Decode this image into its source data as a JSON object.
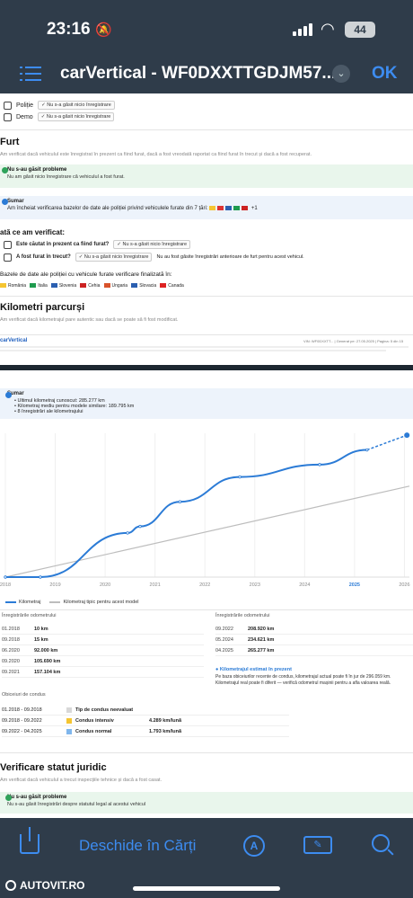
{
  "status_bar": {
    "time": "23:16",
    "battery": "44"
  },
  "nav": {
    "title": "carVertical - WF0DXXTTGDJM57...",
    "ok": "OK"
  },
  "page1": {
    "top_rows": [
      {
        "label": "Poliție",
        "chip": "Nu s-a găsit nicio înregistrare"
      },
      {
        "label": "Demo",
        "chip": "Nu s-a găsit nicio înregistrare"
      }
    ],
    "furt": {
      "heading": "Furt",
      "subtitle": "Am verificat dacă vehiculul este înregistrat în prezent ca fiind furat, dacă a fost vreodată raportat ca fiind furat în trecut și dacă a fost recuperat.",
      "ok_title": "Nu s-au găsit probleme",
      "ok_desc": "Nu am găsit nicio înregistrare că vehiculul a fost furat.",
      "summary_title": "Sumar",
      "summary_text": "Am încheiat verificarea bazelor de date ale poliției privind vehiculele furate din 7 țări:",
      "summary_more": "+1",
      "checked_heading": "ată ce am verificat:",
      "q1": "Este căutat în prezent ca fiind furat?",
      "q1_chip": "Nu s-a găsit nicio înregistrare",
      "q2": "A fost furat în trecut?",
      "q2_chip": "Nu s-a găsit nicio înregistrare",
      "q2_note": "Nu au fost găsite înregistrări anterioare de furt pentru acest vehicul.",
      "db_heading": "Bazele de date ale poliției cu vehicule furate verificare finalizată în:",
      "countries": [
        "România",
        "Italia",
        "Slovenia",
        "Cehia",
        "Ungaria",
        "Slovacia",
        "Canada"
      ]
    },
    "km": {
      "heading": "Kilometri parcurși",
      "subtitle": "Am verificat dacă kilometrajul pare autentic sau dacă se poate să fi fost modificat."
    },
    "footer": {
      "brand": "carVertical",
      "vin": "VIN: WF0DXXTT...",
      "gen": "Generat pe: 27.05.2025",
      "page": "Pagina: 5 din 15"
    }
  },
  "page2": {
    "summary": {
      "title": "Sumar",
      "items": [
        "Ultimul kilometraj cunoscut: 285.277 km",
        "Kilometraj mediu pentru modele similare: 189.795 km",
        "8 înregistrări ale kilometrajului"
      ]
    },
    "chart_data": {
      "type": "line",
      "x_ticks": [
        "2018",
        "2019",
        "2020",
        "2021",
        "2022",
        "2023",
        "2024",
        "2025",
        "2026"
      ],
      "ylim": [
        0,
        300000
      ],
      "series": [
        {
          "name": "Kilometraj",
          "color": "#2b7bd6",
          "x": [
            2018.0,
            2018.7,
            2020.45,
            2020.7,
            2021.5,
            2022.7,
            2024.3,
            2025.25
          ],
          "values": [
            10,
            15,
            92000,
            105690,
            157104,
            208920,
            234621,
            265277
          ]
        },
        {
          "name": "Kilometraj tipic pentru acest model",
          "color": "#bdbdbd",
          "x": [
            2018.0,
            2026.1
          ],
          "values": [
            0,
            189795
          ]
        }
      ]
    },
    "odo_left_title": "Înregistrările odometrului",
    "odo_left": [
      {
        "date": "01.2018",
        "value": "10 km"
      },
      {
        "date": "09.2018",
        "value": "15 km"
      },
      {
        "date": "06.2020",
        "value": "92.000 km"
      },
      {
        "date": "09.2020",
        "value": "105.690 km"
      },
      {
        "date": "09.2021",
        "value": "157.104 km"
      }
    ],
    "odo_right_title": "Înregistrările odometrului",
    "odo_right": [
      {
        "date": "09.2022",
        "value": "208.920 km"
      },
      {
        "date": "05.2024",
        "value": "234.621 km"
      },
      {
        "date": "04.2025",
        "value": "265.277 km"
      }
    ],
    "estimate_title": "Kilometrajul estimat în prezent",
    "estimate_text": "Pe baza obiceiurilor recente de condus, kilometrajul actual poate fi în jur de 296.059 km. Kilometrajul real poate fi diferit — verifică odometrul mașinii pentru a afla valoarea reală.",
    "habits_title": "Obiceiuri de condus",
    "habits": [
      {
        "period": "01.2018 - 09.2018",
        "type": "Tip de condus neevaluat",
        "value": "",
        "color": "#d8d8d8"
      },
      {
        "period": "09.2018 - 09.2022",
        "type": "Condus intensiv",
        "value": "4.289 km/lună",
        "color": "#f5c531"
      },
      {
        "period": "09.2022 - 04.2025",
        "type": "Condus normal",
        "value": "1.793 km/lună",
        "color": "#7fb6ec"
      }
    ],
    "legal": {
      "heading": "Verificare statut juridic",
      "subtitle": "Am verificat dacă vehiculul a trecut inspecțiile tehnice și dacă a fost casat.",
      "ok_title": "Nu s-au găsit probleme",
      "ok_desc": "Nu s-au găsit înregistrări despre statutul legal al acestui vehicul"
    }
  },
  "toolbar": {
    "open_label": "Deschide în Cărți"
  },
  "watermark": "AUTOVIT.RO"
}
